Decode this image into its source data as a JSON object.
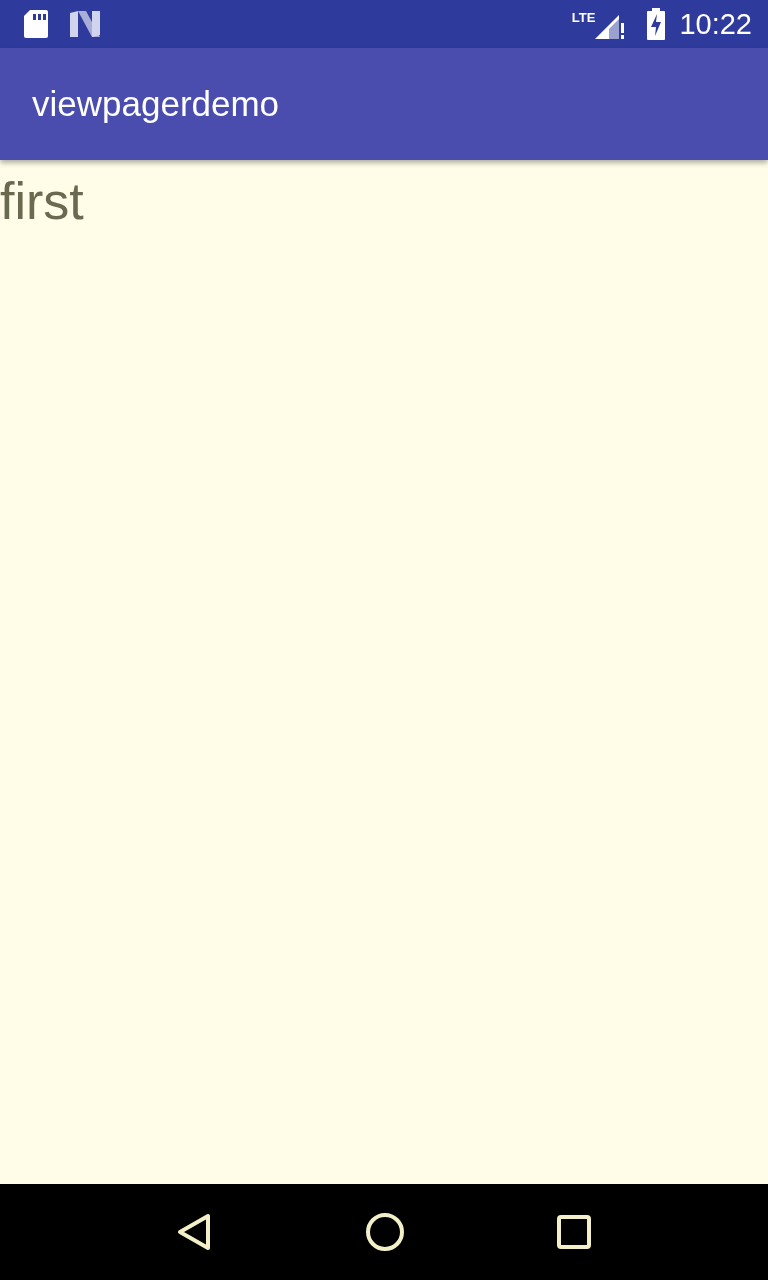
{
  "status_bar": {
    "network_label": "LTE",
    "time": "10:22"
  },
  "app_bar": {
    "title": "viewpagerdemo"
  },
  "page": {
    "text": "first"
  }
}
